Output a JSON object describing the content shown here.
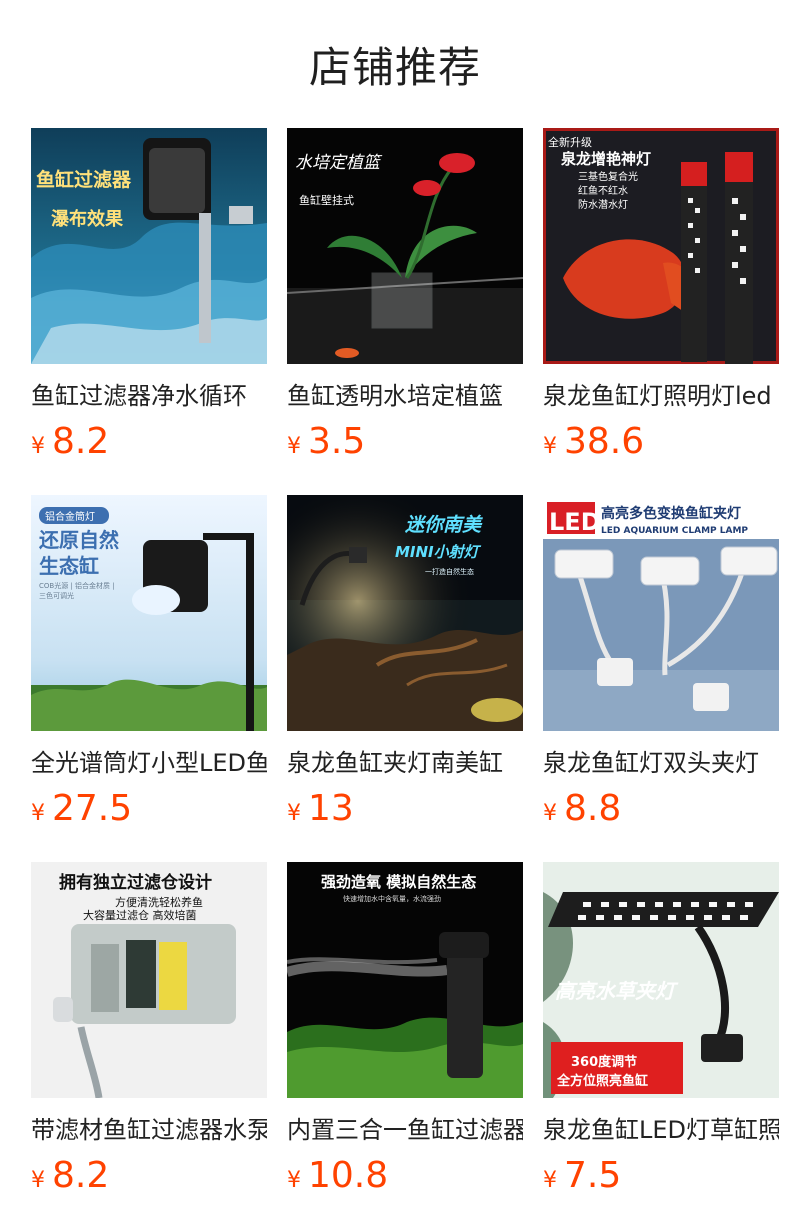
{
  "header": {
    "title": "店铺推荐"
  },
  "currency_symbol": "¥",
  "products": [
    {
      "title": "鱼缸过滤器净水循环",
      "price": "8.2",
      "image_texts": [
        "鱼缸过滤器",
        "瀑布效果"
      ]
    },
    {
      "title": "鱼缸透明水培定植篮",
      "price": "3.5",
      "image_texts": [
        "水培定植篮",
        "鱼缸壁挂式"
      ]
    },
    {
      "title": "泉龙鱼缸灯照明灯led",
      "price": "38.6",
      "image_texts": [
        "全新升级",
        "泉龙增艳神灯",
        "三基色复合光",
        "红鱼不红水",
        "防水潜水灯"
      ]
    },
    {
      "title": "全光谱筒灯小型LED鱼",
      "price": "27.5",
      "image_texts": [
        "铝合金筒灯",
        "还原自然",
        "生态缸",
        "COB光源 | 铝合金材质 |",
        "三色可调光"
      ]
    },
    {
      "title": "泉龙鱼缸夹灯南美缸",
      "price": "13",
      "image_texts": [
        "迷你南美",
        "MINI小射灯",
        "一打造自然生态"
      ]
    },
    {
      "title": "泉龙鱼缸灯双头夹灯",
      "price": "8.8",
      "image_texts": [
        "LED",
        "高亮多色变换鱼缸夹灯",
        "LED AQUARIUM CLAMP LAMP"
      ]
    },
    {
      "title": "带滤材鱼缸过滤器水泵",
      "price": "8.2",
      "image_texts": [
        "拥有独立过滤仓设计",
        "方便清洗轻松养鱼",
        "大容量过滤仓 高效培菌"
      ]
    },
    {
      "title": "内置三合一鱼缸过滤器",
      "price": "10.8",
      "image_texts": [
        "强劲造氧 模拟自然生态",
        "快速增加水中含氧量，水流强劲"
      ]
    },
    {
      "title": "泉龙鱼缸LED灯草缸照明",
      "price": "7.5",
      "image_texts": [
        "高亮水草夹灯",
        "360度调节",
        "全方位照亮鱼缸"
      ]
    }
  ],
  "colors": {
    "price": "#ff4200",
    "title": "#222222",
    "header": "#1f1f1f"
  }
}
